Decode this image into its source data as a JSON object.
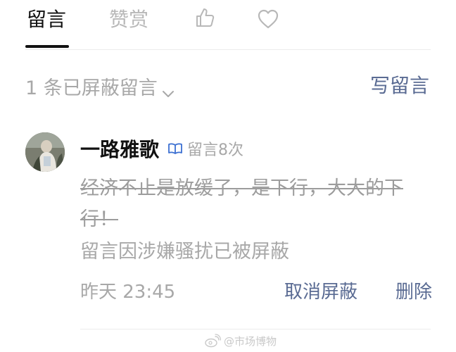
{
  "tabs": {
    "comments_label": "留言",
    "reward_label": "赞赏",
    "like_icon": "thumbs-up-icon",
    "favorite_icon": "heart-icon"
  },
  "filter": {
    "blocked_label": "1 条已屏蔽留言",
    "chevron_icon": "chevron-down-icon",
    "write_label": "写留言"
  },
  "comment": {
    "username": "一路雅歌",
    "badge_icon": "open-book-icon",
    "count_label": "留言8次",
    "struck_text": "经济不止是放缓了，是下行，大大的下行！",
    "notice_text": "留言因涉嫌骚扰已被屏蔽",
    "time": "昨天 23:45",
    "unblock_label": "取消屏蔽",
    "delete_label": "删除"
  },
  "watermark": {
    "text": "@市场博物"
  },
  "colors": {
    "link": "#5a6b93",
    "muted": "#a8a8a8",
    "verify": "#3b6fd1"
  }
}
